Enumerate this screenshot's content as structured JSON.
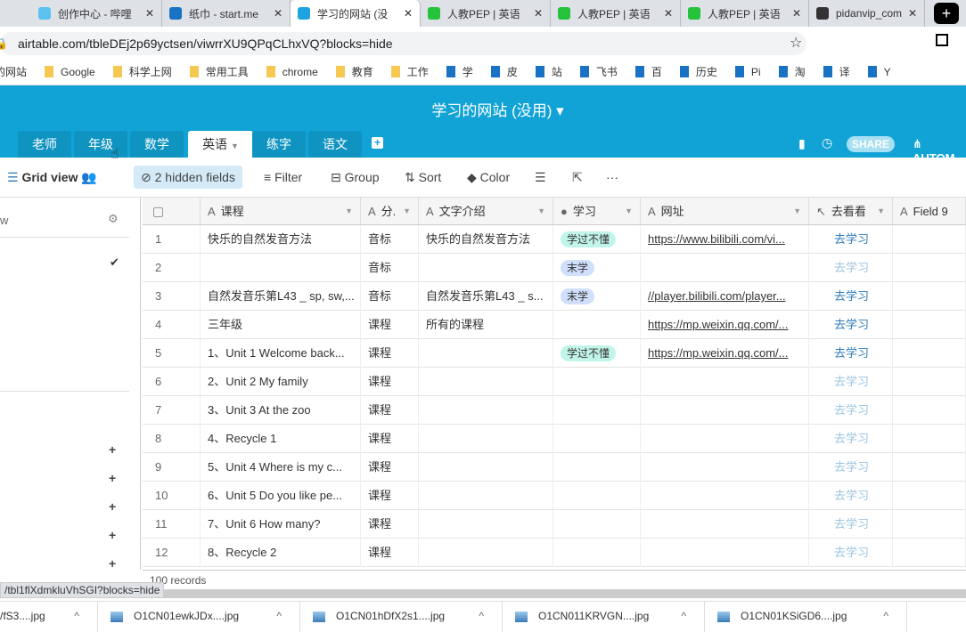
{
  "browser": {
    "tabs": [
      {
        "label": "创作中心 - 哔哩",
        "fav": "#5bc2f0"
      },
      {
        "label": "纸巾 - start.me",
        "fav": "#1a72c4"
      },
      {
        "label": "学习的网站 (没",
        "fav": "#1fa3e0",
        "active": true
      },
      {
        "label": "人教PEP | 英语",
        "fav": "#25c23b"
      },
      {
        "label": "人教PEP | 英语",
        "fav": "#25c23b"
      },
      {
        "label": "人教PEP | 英语",
        "fav": "#25c23b"
      },
      {
        "label": "pidanvip_com",
        "fav": "#333"
      }
    ],
    "url": "airtable.com/tbleDEj2p69yctsen/viwrrXU9QPqCLhxVQ?blocks=hide",
    "bookmarks": [
      "的网站",
      "Google",
      "科学上网",
      "常用工具",
      "chrome",
      "教育",
      "工作",
      "学",
      "皮",
      "站",
      "飞书",
      "百",
      "历史",
      "Pi",
      "淘",
      "译",
      "Y"
    ],
    "status_url": "/tbl1flXdmkluVhSGI?blocks=hide",
    "downloads": [
      "/fS3....jpg",
      "O1CN01ewkJDx....jpg",
      "O1CN01hDfX2s1....jpg",
      "O1CN011KRVGN....jpg",
      "O1CN01KSiGD6....jpg"
    ]
  },
  "app": {
    "title": "学习的网站 (没用)",
    "tabs": [
      "老师",
      "年级",
      "数学",
      "英语",
      "练字",
      "语文"
    ],
    "active_tab": "英语",
    "share": "SHARE",
    "automations": "AUTOM",
    "accent": "#11a3d6"
  },
  "toolbar": {
    "view": "Grid view",
    "hidden": "2 hidden fields",
    "filter": "Filter",
    "group": "Group",
    "sort": "Sort",
    "color": "Color"
  },
  "sidebar": {
    "header": "w"
  },
  "table": {
    "columns": [
      "课程",
      "分.",
      "文字介绍",
      "学习",
      "网址",
      "去看看",
      "Field 9"
    ],
    "rows": [
      [
        "1",
        "快乐的自然发音方法",
        "音标",
        "快乐的自然发音方法",
        "学过不懂",
        "https://www.bilibili.com/vi...",
        "去学习"
      ],
      [
        "2",
        "",
        "音标",
        "",
        "末学",
        "",
        "去学习"
      ],
      [
        "3",
        "自然发音乐第L43 _ sp, sw,...",
        "音标",
        "自然发音乐第L43 _ s...",
        "末学",
        "//player.bilibili.com/player...",
        "去学习"
      ],
      [
        "4",
        "三年级",
        "课程",
        "所有的课程",
        "",
        "https://mp.weixin.qq.com/...",
        "去学习"
      ],
      [
        "5",
        "1、Unit 1 Welcome back...",
        "课程",
        "",
        "学过不懂",
        "https://mp.weixin.qq.com/...",
        "去学习"
      ],
      [
        "6",
        "2、Unit 2 My family",
        "课程",
        "",
        "",
        "",
        "去学习"
      ],
      [
        "7",
        "3、Unit 3 At the zoo",
        "课程",
        "",
        "",
        "",
        "去学习"
      ],
      [
        "8",
        "4、Recycle 1",
        "课程",
        "",
        "",
        "",
        "去学习"
      ],
      [
        "9",
        "5、Unit 4 Where is my c...",
        "课程",
        "",
        "",
        "",
        "去学习"
      ],
      [
        "10",
        "6、Unit 5 Do you like pe...",
        "课程",
        "",
        "",
        "",
        "去学习"
      ],
      [
        "11",
        "7、Unit 6 How many?",
        "课程",
        "",
        "",
        "",
        "去学习"
      ],
      [
        "12",
        "8、Recycle 2",
        "课程",
        "",
        "",
        "",
        "去学习"
      ]
    ],
    "pill_colors": {
      "学过不懂": "#c2f5e9",
      "末学": "#d0e0fc"
    },
    "records": "100 records"
  }
}
